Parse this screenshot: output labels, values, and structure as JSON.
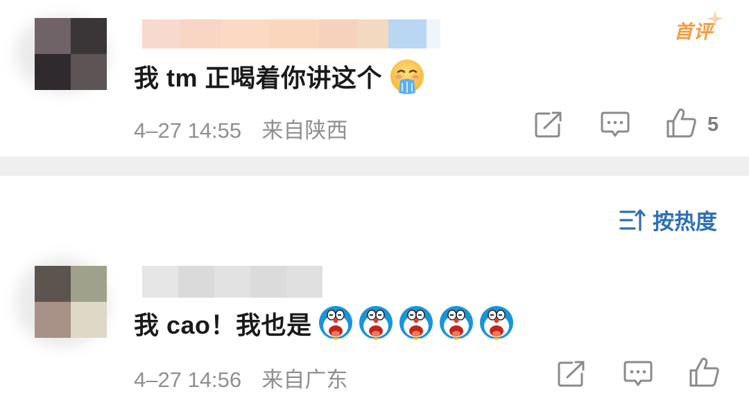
{
  "comments": [
    {
      "text": "我 tm 正喝着你讲这个",
      "time": "4–27 14:55",
      "location": "来自陕西",
      "like_count": "5",
      "badge": "首评",
      "emoji": "vomiting-face"
    },
    {
      "text": "我 cao！我也是",
      "time": "4–27 14:56",
      "location": "来自广东",
      "like_count": "",
      "emoji": "doraemon-face"
    }
  ],
  "sort": {
    "label": "按热度"
  },
  "colors": {
    "accent_blue": "#2c6fb6",
    "badge_orange": "#f59a3a",
    "meta_gray": "#8f8f8f",
    "separator": "#efefef"
  }
}
